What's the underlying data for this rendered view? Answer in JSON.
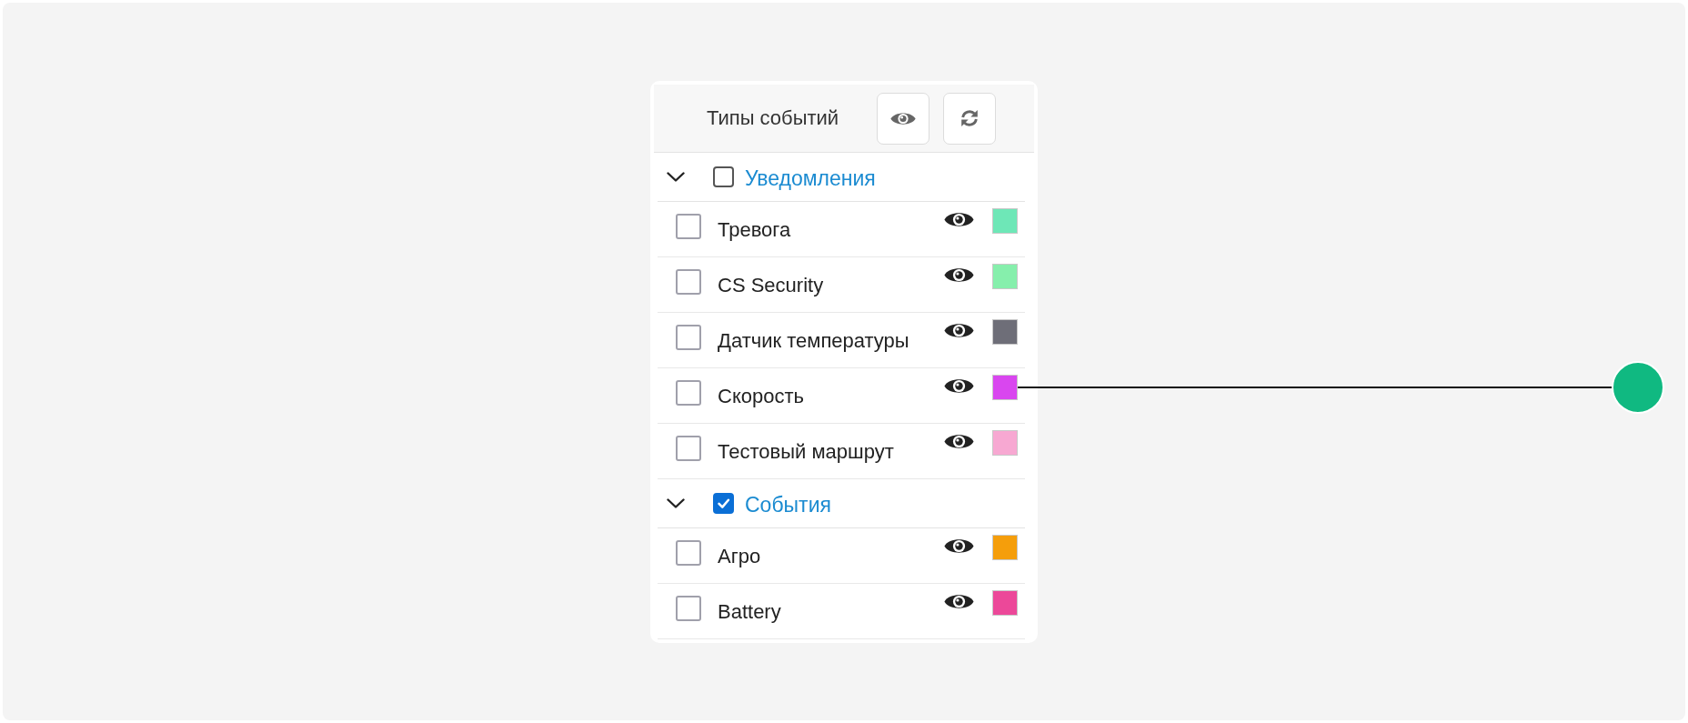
{
  "panel": {
    "title": "Типы событий"
  },
  "groups": [
    {
      "label": "Уведомления",
      "expanded": true,
      "checked": false,
      "items": [
        {
          "label": "Тревога",
          "checked": false,
          "color": "#6ee7b7",
          "pointed": false
        },
        {
          "label": "CS Security",
          "checked": false,
          "color": "#86efac",
          "pointed": false
        },
        {
          "label": "Датчик температуры",
          "checked": false,
          "color": "#6e6e78",
          "pointed": false
        },
        {
          "label": "Скорость",
          "checked": false,
          "color": "#d946ef",
          "pointed": true
        },
        {
          "label": "Тестовый маршрут",
          "checked": false,
          "color": "#f7a8d2",
          "pointed": false
        }
      ]
    },
    {
      "label": "События",
      "expanded": true,
      "checked": true,
      "items": [
        {
          "label": "Агро",
          "checked": false,
          "color": "#f59e0b",
          "pointed": false
        },
        {
          "label": "Battery",
          "checked": false,
          "color": "#ec4899",
          "pointed": false
        }
      ]
    }
  ]
}
